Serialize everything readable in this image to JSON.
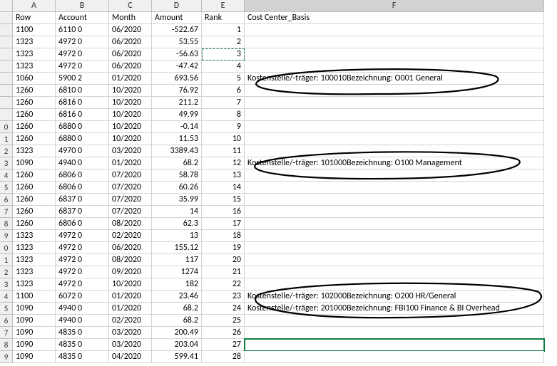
{
  "columns": [
    "A",
    "B",
    "C",
    "D",
    "E",
    "F"
  ],
  "headers": {
    "A": "Row",
    "B": "Account",
    "C": "Month",
    "D": "Amount",
    "E": "Rank",
    "F": "Cost Center_Basis"
  },
  "visible_row_numbers": [
    "",
    "",
    "",
    "",
    "",
    "",
    "",
    "",
    "",
    "0",
    "1",
    "2",
    "3",
    "4",
    "5",
    "6",
    "7",
    "8",
    "9",
    "0",
    "1",
    "2",
    "3",
    "4",
    "5",
    "6",
    "7",
    "8",
    "9"
  ],
  "rows": [
    {
      "A": "1100",
      "B": "6110 0",
      "C": "06/2020",
      "D": "-522.67",
      "E": "1",
      "F": ""
    },
    {
      "A": "1323",
      "B": "4972 0",
      "C": "06/2020",
      "D": "53.55",
      "E": "2",
      "F": ""
    },
    {
      "A": "1323",
      "B": "4972 0",
      "C": "06/2020",
      "D": "-56.63",
      "E": "3",
      "F": ""
    },
    {
      "A": "1323",
      "B": "4972 0",
      "C": "06/2020",
      "D": "-47.42",
      "E": "4",
      "F": ""
    },
    {
      "A": "1060",
      "B": "5900 2",
      "C": "01/2020",
      "D": "693.56",
      "E": "5",
      "F": "Kostenstelle/-träger: 100010Bezeichnung: O001 General"
    },
    {
      "A": "1260",
      "B": "6810 0",
      "C": "10/2020",
      "D": "76.92",
      "E": "6",
      "F": ""
    },
    {
      "A": "1260",
      "B": "6816 0",
      "C": "10/2020",
      "D": "211.2",
      "E": "7",
      "F": ""
    },
    {
      "A": "1260",
      "B": "6816 0",
      "C": "10/2020",
      "D": "49.99",
      "E": "8",
      "F": ""
    },
    {
      "A": "1260",
      "B": "6880 0",
      "C": "10/2020",
      "D": "-0.14",
      "E": "9",
      "F": ""
    },
    {
      "A": "1260",
      "B": "6880 0",
      "C": "10/2020",
      "D": "11.53",
      "E": "10",
      "F": ""
    },
    {
      "A": "1323",
      "B": "4970 0",
      "C": "03/2020",
      "D": "3389.43",
      "E": "11",
      "F": ""
    },
    {
      "A": "1090",
      "B": "4940 0",
      "C": "01/2020",
      "D": "68.2",
      "E": "12",
      "F": "Kostenstelle/-träger: 101000Bezeichnung: O100 Management"
    },
    {
      "A": "1260",
      "B": "6806 0",
      "C": "07/2020",
      "D": "58.78",
      "E": "13",
      "F": ""
    },
    {
      "A": "1260",
      "B": "6806 0",
      "C": "07/2020",
      "D": "60.26",
      "E": "14",
      "F": ""
    },
    {
      "A": "1260",
      "B": "6837 0",
      "C": "07/2020",
      "D": "35.99",
      "E": "15",
      "F": ""
    },
    {
      "A": "1260",
      "B": "6837 0",
      "C": "07/2020",
      "D": "14",
      "E": "16",
      "F": ""
    },
    {
      "A": "1260",
      "B": "6806 0",
      "C": "08/2020",
      "D": "62.3",
      "E": "17",
      "F": ""
    },
    {
      "A": "1323",
      "B": "4972 0",
      "C": "02/2020",
      "D": "13",
      "E": "18",
      "F": ""
    },
    {
      "A": "1323",
      "B": "4972 0",
      "C": "06/2020",
      "D": "155.12",
      "E": "19",
      "F": ""
    },
    {
      "A": "1323",
      "B": "4972 0",
      "C": "08/2020",
      "D": "117",
      "E": "20",
      "F": ""
    },
    {
      "A": "1323",
      "B": "4972 0",
      "C": "09/2020",
      "D": "1274",
      "E": "21",
      "F": ""
    },
    {
      "A": "1323",
      "B": "4972 0",
      "C": "10/2020",
      "D": "182",
      "E": "22",
      "F": ""
    },
    {
      "A": "1100",
      "B": "6072 0",
      "C": "01/2020",
      "D": "23.46",
      "E": "23",
      "F": "Kostenstelle/-träger: 102000Bezeichnung: O200 HR/General"
    },
    {
      "A": "1090",
      "B": "4940 0",
      "C": "01/2020",
      "D": "68.2",
      "E": "24",
      "F": "Kostenstelle/-träger: 201000Bezeichnung: FBI100 Finance & BI Overhead"
    },
    {
      "A": "1090",
      "B": "4940 0",
      "C": "02/2020",
      "D": "68.2",
      "E": "25",
      "F": ""
    },
    {
      "A": "1090",
      "B": "4835 0",
      "C": "03/2020",
      "D": "200.49",
      "E": "26",
      "F": ""
    },
    {
      "A": "1090",
      "B": "4835 0",
      "C": "03/2020",
      "D": "203.04",
      "E": "27",
      "F": ""
    },
    {
      "A": "1090",
      "B": "4835 0",
      "C": "04/2020",
      "D": "599.41",
      "E": "28",
      "F": ""
    }
  ],
  "copied_cell_row_index": 2,
  "copied_cell_col": "E",
  "selected_cell_row_index": 26,
  "selected_cell_col": "F"
}
